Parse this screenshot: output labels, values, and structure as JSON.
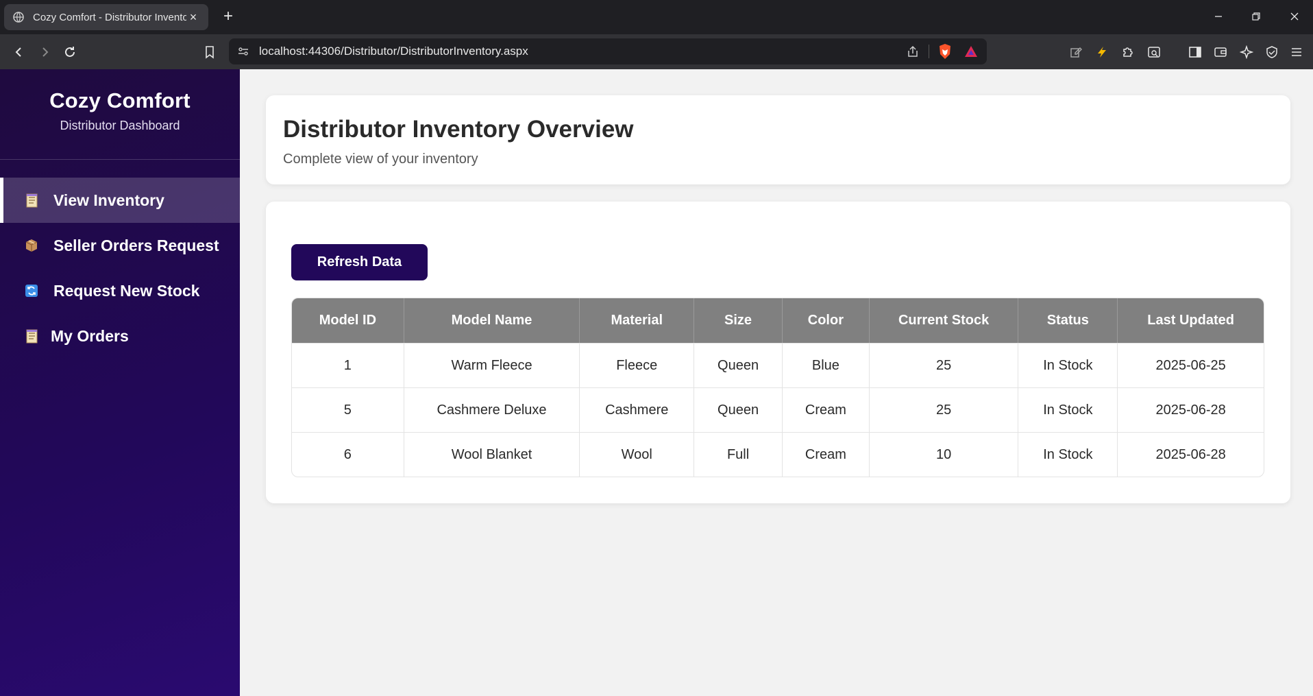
{
  "browser": {
    "tab_title": "Cozy Comfort - Distributor Inventory",
    "url": "localhost:44306/Distributor/DistributorInventory.aspx"
  },
  "sidebar": {
    "brand_title": "Cozy Comfort",
    "brand_subtitle": "Distributor Dashboard",
    "items": [
      {
        "label": "View Inventory",
        "icon": "notepad-icon",
        "active": true
      },
      {
        "label": "Seller Orders Request",
        "icon": "package-icon",
        "active": false
      },
      {
        "label": "Request New Stock",
        "icon": "refresh-icon",
        "active": false
      },
      {
        "label": "My Orders",
        "icon": "notepad-icon",
        "active": false
      }
    ]
  },
  "header": {
    "title": "Distributor Inventory Overview",
    "subtitle": "Complete view of your inventory"
  },
  "main": {
    "refresh_label": "Refresh Data",
    "columns": [
      "Model ID",
      "Model Name",
      "Material",
      "Size",
      "Color",
      "Current Stock",
      "Status",
      "Last Updated"
    ],
    "rows": [
      [
        "1",
        "Warm Fleece",
        "Fleece",
        "Queen",
        "Blue",
        "25",
        "In Stock",
        "2025-06-25"
      ],
      [
        "5",
        "Cashmere Deluxe",
        "Cashmere",
        "Queen",
        "Cream",
        "25",
        "In Stock",
        "2025-06-28"
      ],
      [
        "6",
        "Wool Blanket",
        "Wool",
        "Full",
        "Cream",
        "10",
        "In Stock",
        "2025-06-28"
      ]
    ]
  },
  "colors": {
    "sidebar_bg": "#22085a",
    "button_bg": "#22085a",
    "table_header_bg": "#808080"
  }
}
